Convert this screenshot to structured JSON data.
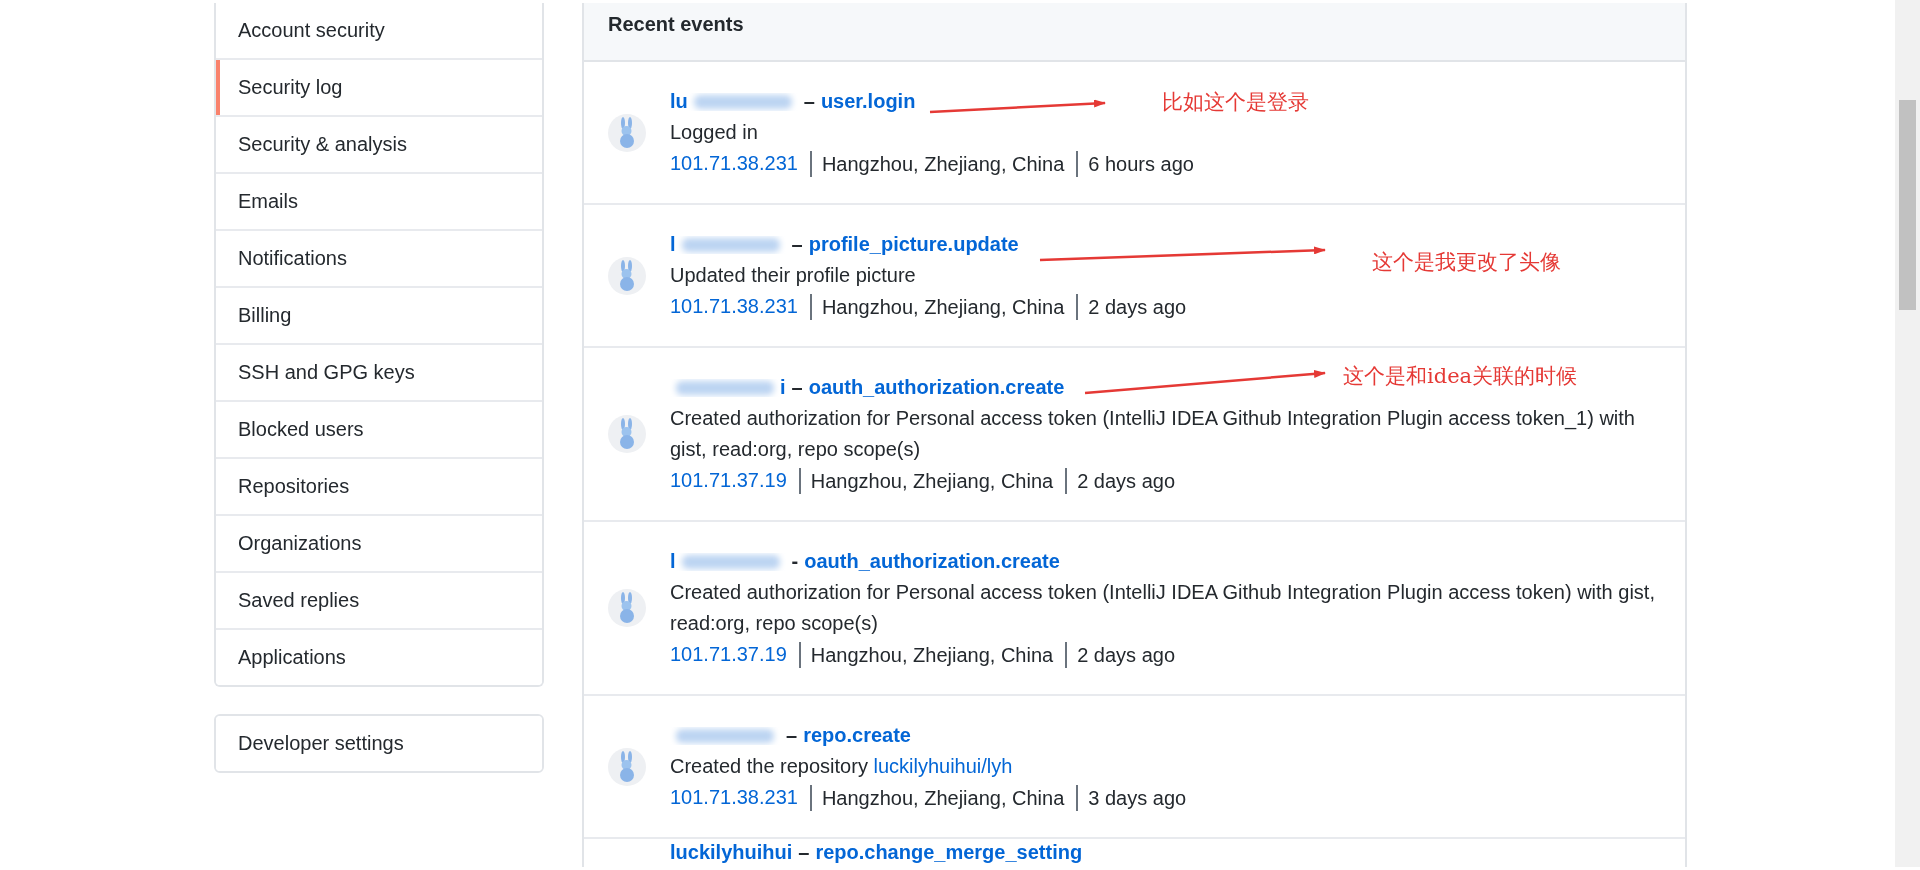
{
  "sidebar": {
    "groups": [
      {
        "items": [
          {
            "label": "Account security",
            "selected": false
          },
          {
            "label": "Security log",
            "selected": true
          },
          {
            "label": "Security & analysis",
            "selected": false
          },
          {
            "label": "Emails",
            "selected": false
          },
          {
            "label": "Notifications",
            "selected": false
          },
          {
            "label": "Billing",
            "selected": false
          },
          {
            "label": "SSH and GPG keys",
            "selected": false
          },
          {
            "label": "Blocked users",
            "selected": false
          },
          {
            "label": "Repositories",
            "selected": false
          },
          {
            "label": "Organizations",
            "selected": false
          },
          {
            "label": "Saved replies",
            "selected": false
          },
          {
            "label": "Applications",
            "selected": false
          }
        ]
      },
      {
        "items": [
          {
            "label": "Developer settings",
            "selected": false
          }
        ]
      }
    ]
  },
  "events": {
    "title": "Recent events",
    "items": [
      {
        "actor_prefix": "lu",
        "separator": "–",
        "action": "user.login",
        "description": "Logged in",
        "ip": "101.71.38.231",
        "location": "Hangzhou, Zhejiang, China",
        "time": "6 hours ago"
      },
      {
        "actor_prefix": "l",
        "separator": "–",
        "action": "profile_picture.update",
        "description": "Updated their profile picture",
        "ip": "101.71.38.231",
        "location": "Hangzhou, Zhejiang, China",
        "time": "2 days ago"
      },
      {
        "actor_suffix": "i",
        "separator": "–",
        "action": "oauth_authorization.create",
        "description": "Created authorization for Personal access token (IntelliJ IDEA Github Integration Plugin access token_1) with gist, read:org, repo scope(s)",
        "ip": "101.71.37.19",
        "location": "Hangzhou, Zhejiang, China",
        "time": "2 days ago"
      },
      {
        "actor_prefix": "l",
        "separator": "-",
        "action": "oauth_authorization.create",
        "description": "Created authorization for Personal access token (IntelliJ IDEA Github Integration Plugin access token) with gist, read:org, repo scope(s)",
        "ip": "101.71.37.19",
        "location": "Hangzhou, Zhejiang, China",
        "time": "2 days ago"
      },
      {
        "separator": "–",
        "action": "repo.create",
        "description": "Created the repository",
        "link": "luckilyhuihui/lyh",
        "ip": "101.71.38.231",
        "location": "Hangzhou, Zhejiang, China",
        "time": "3 days ago"
      },
      {
        "actor": "luckilyhuihui",
        "separator": "–",
        "action": "repo.change_merge_setting"
      }
    ]
  },
  "annotations": [
    {
      "text": "比如这个是登录"
    },
    {
      "text": "这个是我更改了头像"
    },
    {
      "text": "这个是和idea关联的时候"
    }
  ]
}
